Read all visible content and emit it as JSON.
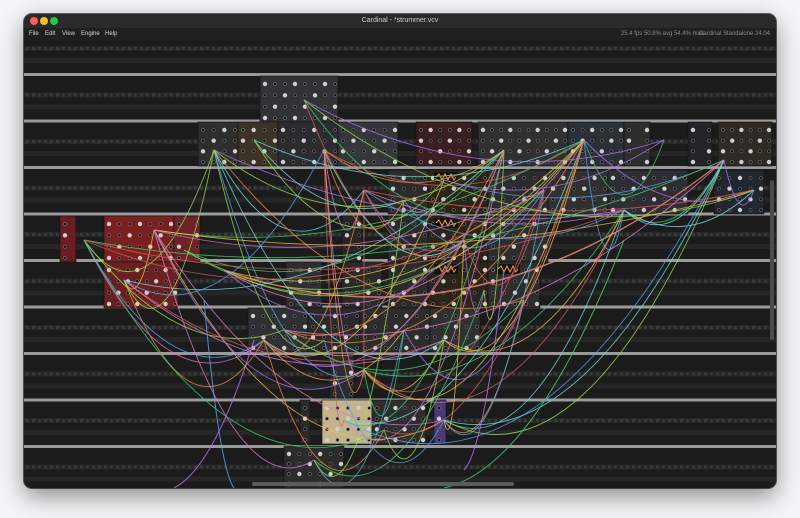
{
  "window": {
    "title": "Cardinal - *strummer.vcv"
  },
  "menu": {
    "items": [
      {
        "label": "File",
        "name": "menu-file"
      },
      {
        "label": "Edit",
        "name": "menu-edit"
      },
      {
        "label": "View",
        "name": "menu-view"
      },
      {
        "label": "Engine",
        "name": "menu-engine"
      },
      {
        "label": "Help",
        "name": "menu-help"
      }
    ]
  },
  "status": {
    "fps": "25.4 fps  50.8% avg  54.4% max",
    "version": "Cardinal Standalone 24.04"
  },
  "colors": {
    "cables": [
      "#3fd06a",
      "#e05a5a",
      "#f0c040",
      "#5aa0f0",
      "#b070f0",
      "#e07ad0",
      "#70e0e0",
      "#f09040",
      "#9be04a"
    ],
    "rail": "#9a9a9a",
    "rack_bg": "#1b1b1b"
  }
}
